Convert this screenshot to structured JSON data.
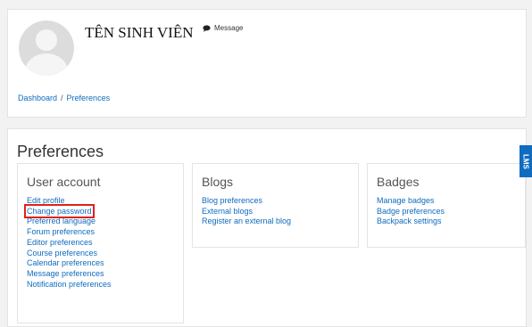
{
  "header": {
    "student_name": "TÊN SINH VIÊN",
    "message_label": "Message",
    "breadcrumb": [
      "Dashboard",
      "Preferences"
    ],
    "breadcrumb_sep": "/"
  },
  "page_title": "Preferences",
  "sections": {
    "user_account": {
      "title": "User account",
      "links": [
        "Edit profile",
        "Change password",
        "Preferred language",
        "Forum preferences",
        "Editor preferences",
        "Course preferences",
        "Calendar preferences",
        "Message preferences",
        "Notification preferences"
      ]
    },
    "blogs": {
      "title": "Blogs",
      "links": [
        "Blog preferences",
        "External blogs",
        "Register an external blog"
      ]
    },
    "badges": {
      "title": "Badges",
      "links": [
        "Manage badges",
        "Badge preferences",
        "Backpack settings"
      ]
    }
  },
  "side_tab": "LMS",
  "highlighted_link": "Change password",
  "colors": {
    "link": "#0f6cbf",
    "highlight_border": "#e0201b",
    "tab": "#0f6cbf"
  },
  "icons": {
    "message": "speech-bubble-icon"
  }
}
